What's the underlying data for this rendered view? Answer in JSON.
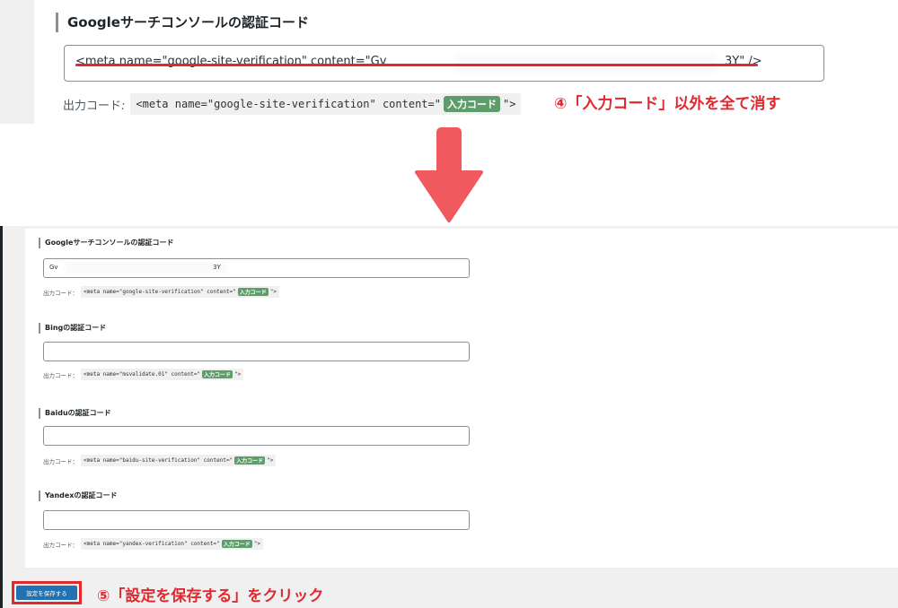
{
  "step4": {
    "heading": "Googleサーチコンソールの認証コード",
    "input_value_start": "<meta name=\"google-site-verification\" content=\"Gv",
    "input_value_end": "3Y\" />",
    "output_label": "出力コード",
    "output_sep": ":",
    "output_code_start": "<meta name=\"google-site-verification\" content=\"",
    "output_badge": "入力コード",
    "output_code_end": "\">",
    "annotation": "④「入力コード」以外を全て消す"
  },
  "settings": {
    "fields": [
      {
        "heading": "Googleサーチコンソールの認証コード",
        "value_start": "Gv",
        "value_end": "3Y",
        "output_label": "出力コード：",
        "code_start": "<meta name=\"google-site-verification\" content=\"",
        "badge": "入力コード",
        "code_end": "\">"
      },
      {
        "heading": "Bingの認証コード",
        "value_start": "",
        "value_end": "",
        "output_label": "出力コード：",
        "code_start": "<meta name=\"msvalidate.01\" content=\"",
        "badge": "入力コード",
        "code_end": "\">"
      },
      {
        "heading": "Baiduの認証コード",
        "value_start": "",
        "value_end": "",
        "output_label": "出力コード：",
        "code_start": "<meta name=\"baidu-site-verification\" content=\"",
        "badge": "入力コード",
        "code_end": "\">"
      },
      {
        "heading": "Yandexの認証コード",
        "value_start": "",
        "value_end": "",
        "output_label": "出力コード：",
        "code_start": "<meta name=\"yandex-verification\" content=\"",
        "badge": "入力コード",
        "code_end": "\">"
      }
    ],
    "save_label": "設定を保存する",
    "annotation": "⑤「設定を保存する」をクリック"
  },
  "colors": {
    "annotation_red": "#e0282e",
    "badge_green": "#5e9d6b",
    "button_blue": "#2271b1"
  }
}
